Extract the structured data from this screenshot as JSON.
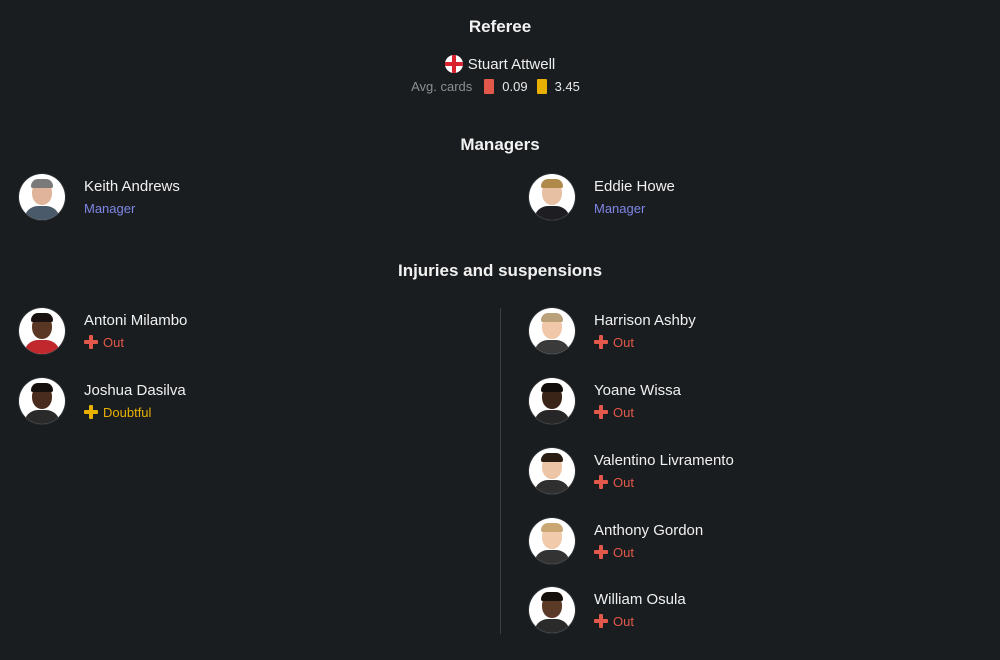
{
  "referee": {
    "section_title": "Referee",
    "name": "Stuart Attwell",
    "flag_icon": "england-flag-icon",
    "avg_cards_label": "Avg. cards",
    "red_avg": "0.09",
    "yellow_avg": "3.45",
    "red_color": "#e2584a",
    "yellow_color": "#e8b000"
  },
  "managers": {
    "section_title": "Managers",
    "home": {
      "name": "Keith Andrews",
      "role": "Manager"
    },
    "away": {
      "name": "Eddie Howe",
      "role": "Manager"
    }
  },
  "injuries": {
    "section_title": "Injuries and suspensions",
    "home": [
      {
        "name": "Antoni Milambo",
        "status": "Out"
      },
      {
        "name": "Joshua Dasilva",
        "status": "Doubtful"
      }
    ],
    "away": [
      {
        "name": "Harrison Ashby",
        "status": "Out"
      },
      {
        "name": "Yoane Wissa",
        "status": "Out"
      },
      {
        "name": "Valentino Livramento",
        "status": "Out"
      },
      {
        "name": "Anthony Gordon",
        "status": "Out"
      },
      {
        "name": "William Osula",
        "status": "Out"
      }
    ]
  },
  "colors": {
    "background": "#1a1d1f",
    "manager_role": "#7f86e6",
    "out": "#e2584a",
    "doubtful": "#e8b100"
  }
}
